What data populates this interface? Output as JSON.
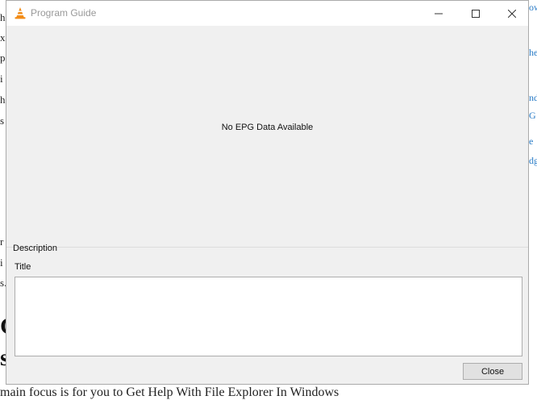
{
  "background": {
    "left_fragments": [
      "h",
      "x",
      "p",
      "i",
      "h",
      "s",
      "r",
      "i",
      "s."
    ],
    "right_fragments": [
      "ow",
      "he",
      "nd",
      "G",
      "e",
      "dg"
    ],
    "big_fragments": [
      "G",
      "s"
    ],
    "bottom_text": "main focus is for you to Get Help With File Explorer In Windows"
  },
  "window": {
    "title": "Program Guide",
    "app_icon": "vlc-cone-icon",
    "controls": [
      "minimize-icon",
      "maximize-icon",
      "close-icon"
    ]
  },
  "epg": {
    "message": "No EPG Data Available"
  },
  "description": {
    "section_label": "Description",
    "title_label": "Title",
    "text": ""
  },
  "footer": {
    "close_label": "Close"
  },
  "colors": {
    "dialog_bg": "#f0f0f0",
    "titlebar_bg": "#ffffff",
    "vlc_orange": "#f28c18"
  }
}
